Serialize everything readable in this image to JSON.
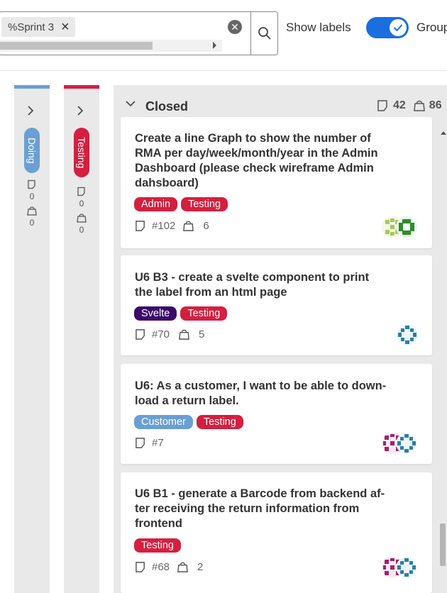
{
  "toolbar": {
    "filter_chip": "%Sprint 3",
    "show_labels_label": "Show labels",
    "show_labels_on": true,
    "group_label": "Group"
  },
  "columns": {
    "doing": {
      "label": "Doing",
      "color": "#6a9fd4",
      "stat1": "0",
      "stat2": "0"
    },
    "testing": {
      "label": "Testing",
      "color": "#d51f3f",
      "stat1": "0",
      "stat2": "0"
    },
    "closed": {
      "title": "Closed",
      "issue_count": "42",
      "weight": "86"
    }
  },
  "cards": [
    {
      "title_lines": [
        "Create a line Graph to show the number of",
        "RMA per day/week/month/year in the Admin",
        "Dashboard (please check wireframe Admin",
        "dahsboard)"
      ],
      "tags": [
        {
          "label": "Admin",
          "color": "#d51f3f"
        },
        {
          "label": "Testing",
          "color": "#d51f3f"
        }
      ],
      "issue": "#102",
      "weight": "6"
    },
    {
      "title_lines": [
        "U6 B3 - create a svelte component to print",
        "the label from an html page"
      ],
      "tags": [
        {
          "label": "Svelte",
          "color": "#3b0a6b"
        },
        {
          "label": "Testing",
          "color": "#d51f3f"
        }
      ],
      "issue": "#70",
      "weight": "5"
    },
    {
      "title_lines": [
        "U6: As a customer, I want to be able to down-",
        "load a return label."
      ],
      "tags": [
        {
          "label": "Customer",
          "color": "#6a9fd4"
        },
        {
          "label": "Testing",
          "color": "#d51f3f"
        }
      ],
      "issue": "#7",
      "weight": ""
    },
    {
      "title_lines": [
        "U6 B1 - generate a Barcode from backend af-",
        "ter receiving the return information from",
        "frontend"
      ],
      "tags": [
        {
          "label": "Testing",
          "color": "#d51f3f"
        }
      ],
      "issue": "#68",
      "weight": "2"
    }
  ]
}
